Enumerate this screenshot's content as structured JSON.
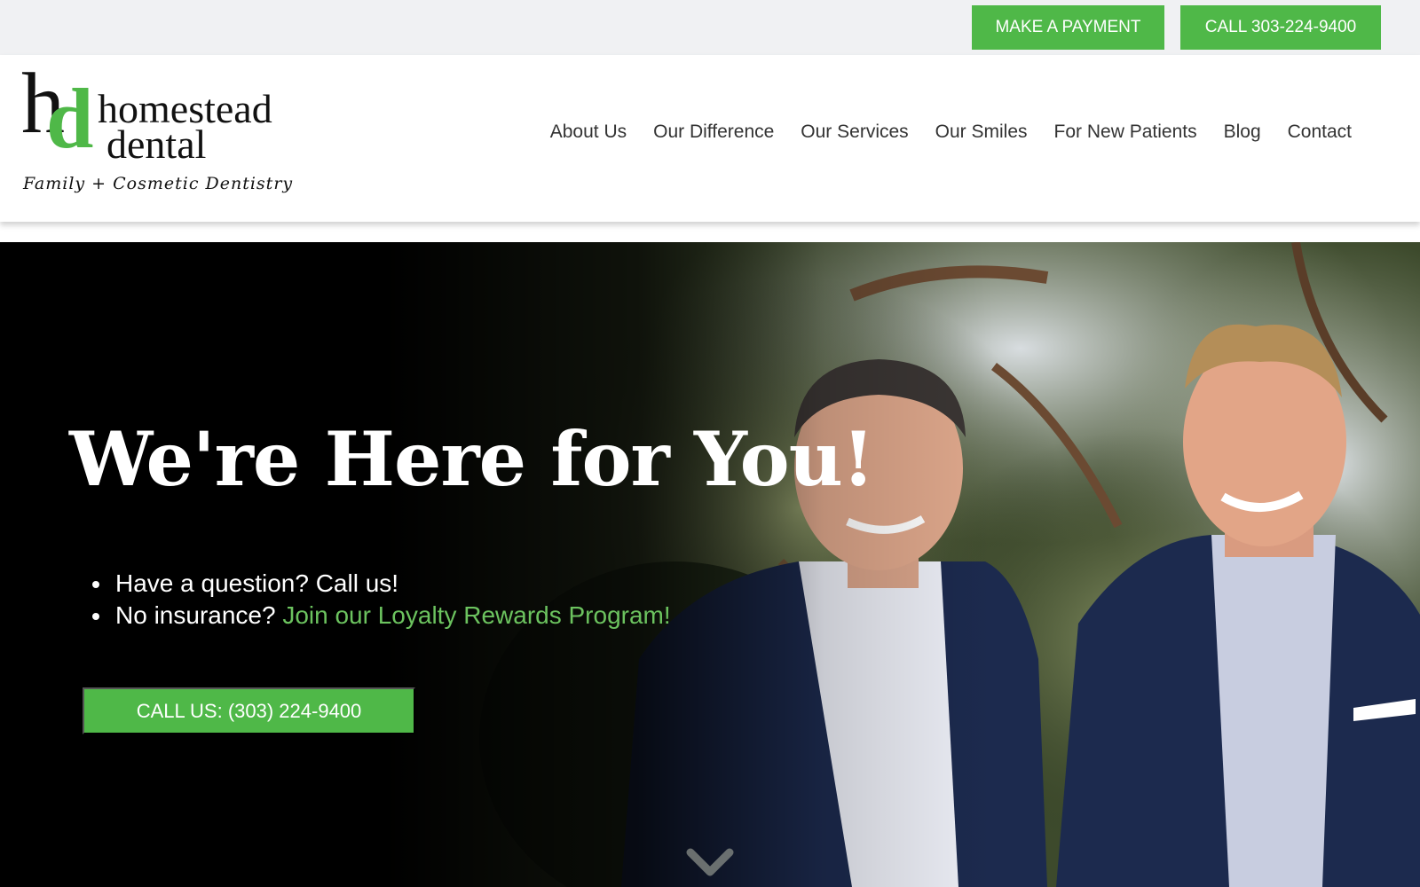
{
  "topbar": {
    "payment_label": "MAKE A PAYMENT",
    "call_label": "CALL 303-224-9400"
  },
  "logo": {
    "monogram_h": "h",
    "monogram_d": "d",
    "word1": "homestead",
    "word2": "dental",
    "tagline": "Family + Cosmetic Dentistry"
  },
  "nav": {
    "items": [
      {
        "label": "About Us"
      },
      {
        "label": "Our Difference"
      },
      {
        "label": "Our Services"
      },
      {
        "label": "Our Smiles"
      },
      {
        "label": "For New Patients"
      },
      {
        "label": "Blog"
      },
      {
        "label": "Contact"
      }
    ]
  },
  "hero": {
    "title": "We're Here for You!",
    "bullets": {
      "question": "Have a question? Call us!",
      "insurance_prefix": "No insurance? ",
      "insurance_link": "Join our Loyalty Rewards Program!"
    },
    "cta_label": "CALL US: (303) 224-9400",
    "scroll_icon": "chevron-down-icon"
  },
  "colors": {
    "brand_green": "#4fb848",
    "link_green": "#6cc35f",
    "topbar_bg": "#f0f1f3",
    "nav_text": "#333333",
    "blazer_navy": "#1c2a4e"
  }
}
